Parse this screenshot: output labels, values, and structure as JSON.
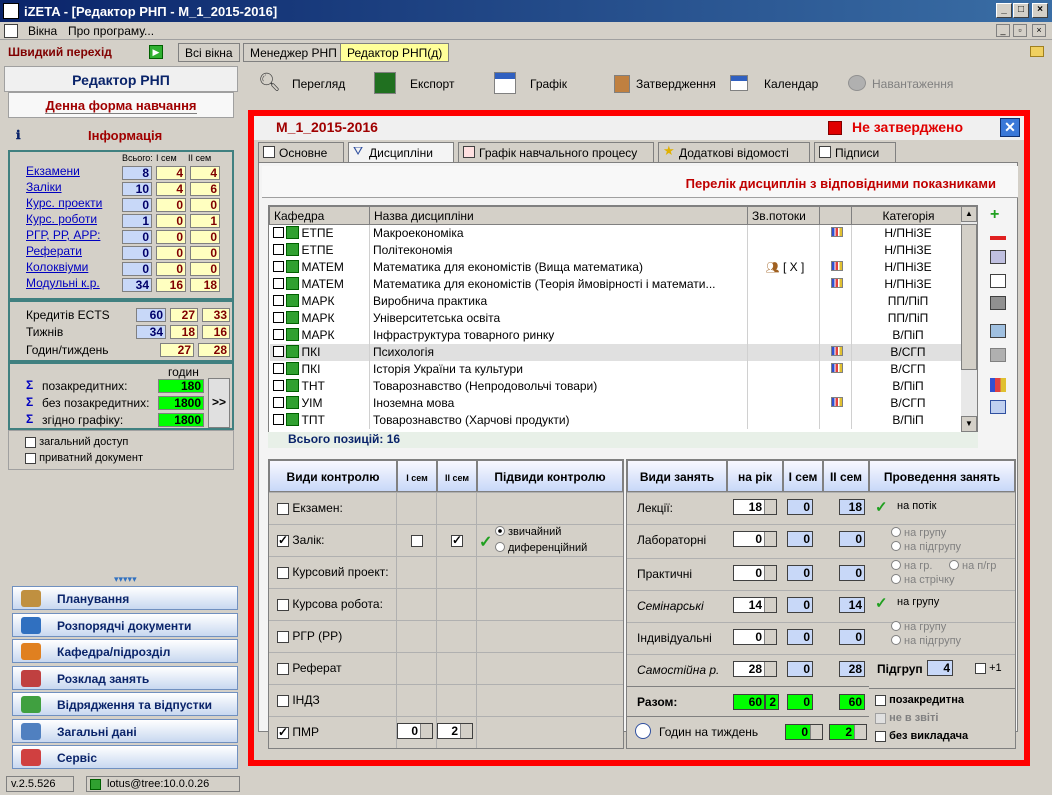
{
  "window": {
    "title": "iZETA - [Редактор РНП - М_1_2015-2016]"
  },
  "menu": [
    "Вікна",
    "Про програму..."
  ],
  "quick": {
    "label": "Швидкий перехід",
    "tabs": [
      "Всі вікна",
      "Менеджер РНП",
      "Редактор РНП(д)"
    ]
  },
  "left": {
    "title": "Редактор РНП",
    "form": "Денна форма навчання",
    "info": "Інформація",
    "cols": [
      "Всього:",
      "I сем",
      "II сем"
    ],
    "rows": [
      {
        "label": "Екзамени",
        "v": [
          "8",
          "4",
          "4"
        ]
      },
      {
        "label": "Заліки",
        "v": [
          "10",
          "4",
          "6"
        ]
      },
      {
        "label": "Курс. проекти",
        "v": [
          "0",
          "0",
          "0"
        ]
      },
      {
        "label": "Курс. роботи",
        "v": [
          "1",
          "0",
          "1"
        ]
      },
      {
        "label": "РГР, РР, АРР:",
        "v": [
          "0",
          "0",
          "0"
        ]
      },
      {
        "label": "Реферати",
        "v": [
          "0",
          "0",
          "0"
        ]
      },
      {
        "label": "Колоквіуми",
        "v": [
          "0",
          "0",
          "0"
        ]
      },
      {
        "label": "Модульні к.р.",
        "v": [
          "34",
          "16",
          "18"
        ]
      }
    ],
    "ects": {
      "label": "Кредитів ECTS",
      "v": [
        "60",
        "27",
        "33"
      ]
    },
    "weeks": {
      "label": "Тижнів",
      "v": [
        "34",
        "18",
        "16"
      ]
    },
    "hpw": {
      "label": "Годин/тиждень",
      "v": [
        "27",
        "28"
      ]
    },
    "hours_label": "годин",
    "sums": [
      {
        "label": "позакредитних:",
        "v": "180"
      },
      {
        "label": "без позакредитних:",
        "v": "1800"
      },
      {
        "label": "згідно графіку:",
        "v": "1800"
      }
    ],
    "more": ">>",
    "public": "загальний доступ",
    "private": "приватний документ",
    "nav": [
      "Планування",
      "Розпорядчі документи",
      "Кафедра/підрозділ",
      "Розклад занять",
      "Відрядження та відпустки",
      "Загальні дані",
      "Сервіс"
    ],
    "version": "v.2.5.526",
    "user": "lotus@tree:10.0.0.26"
  },
  "toolbar": [
    "Перегляд",
    "Експорт",
    "Графік",
    "Затвердження",
    "Календар",
    "Навантаження"
  ],
  "doc": {
    "name": "М_1_2015-2016",
    "status": "Не затверджено"
  },
  "tabs": [
    "Основне",
    "Дисципліни",
    "Графік навчального процесу",
    "Додаткові відомості",
    "Підписи"
  ],
  "section_title": "Перелік дисциплін з відповідними показниками",
  "table": {
    "headers": [
      "Кафедра",
      "Назва дисципліни",
      "Зв.потоки",
      "",
      "Категорія"
    ],
    "rows": [
      {
        "dept": "ЕТПЕ",
        "name": "Макроекономіка",
        "streams": "",
        "chart": true,
        "cat": "Н/ПНіЗЕ"
      },
      {
        "dept": "ЕТПЕ",
        "name": "Політекономія",
        "streams": "",
        "chart": false,
        "cat": "Н/ПНіЗЕ"
      },
      {
        "dept": "МАТЕМ",
        "name": "Математика для економістів (Вища математика)",
        "streams": "[ X ]",
        "chart": true,
        "cat": "Н/ПНіЗЕ"
      },
      {
        "dept": "МАТЕМ",
        "name": "Математика для економістів (Теорія ймовірності і математи...",
        "streams": "",
        "chart": true,
        "cat": "Н/ПНіЗЕ"
      },
      {
        "dept": "МАРК",
        "name": "Виробнича практика",
        "streams": "",
        "chart": false,
        "cat": "ПП/ПіП"
      },
      {
        "dept": "МАРК",
        "name": "Університетська освіта",
        "streams": "",
        "chart": false,
        "cat": "ПП/ПіП"
      },
      {
        "dept": "МАРК",
        "name": "Інфраструктура товарного ринку",
        "streams": "",
        "chart": false,
        "cat": "В/ПіП"
      },
      {
        "dept": "ПКІ",
        "name": "Психологія",
        "streams": "",
        "chart": true,
        "cat": "В/СГП"
      },
      {
        "dept": "ПКІ",
        "name": "Історія України та культури",
        "streams": "",
        "chart": true,
        "cat": "В/СГП"
      },
      {
        "dept": "ТНТ",
        "name": "Товарознавство (Непродовольчі товари)",
        "streams": "",
        "chart": false,
        "cat": "В/ПіП"
      },
      {
        "dept": "УІМ",
        "name": "Іноземна мова",
        "streams": "",
        "chart": true,
        "cat": "В/СГП"
      },
      {
        "dept": "ТПТ",
        "name": "Товарознавство (Харчові продукти)",
        "streams": "",
        "chart": false,
        "cat": "В/ПіП"
      }
    ],
    "total": "Всього позицій: 16"
  },
  "control": {
    "headers": [
      "Види контролю",
      "I сем",
      "II сем",
      "Підвиди контролю"
    ],
    "rows": [
      "Екзамен:",
      "Залік:",
      "Курсовий проект:",
      "Курсова робота:",
      "РГР (РР)",
      "Реферат",
      "ІНДЗ",
      "ПМР"
    ],
    "subtypes": [
      "звичайний",
      "диференційний"
    ],
    "pmr": [
      "0",
      "2"
    ]
  },
  "classes": {
    "headers": [
      "Види занять",
      "на рік",
      "I сем",
      "II сем",
      "Проведення занять"
    ],
    "rows": [
      {
        "label": "Лекції:",
        "year": "18",
        "s1": "0",
        "s2": "18"
      },
      {
        "label": "Лабораторні",
        "year": "0",
        "s1": "0",
        "s2": "0"
      },
      {
        "label": "Практичні",
        "year": "0",
        "s1": "0",
        "s2": "0"
      },
      {
        "label": "Семінарські",
        "year": "14",
        "s1": "0",
        "s2": "14"
      },
      {
        "label": "Індивідуальні",
        "year": "0",
        "s1": "0",
        "s2": "0"
      },
      {
        "label": "Самостійна р.",
        "year": "28",
        "s1": "0",
        "s2": "28"
      }
    ],
    "total": {
      "label": "Разом:",
      "year": "60",
      "year2": "2",
      "s1": "0",
      "s2": "60"
    },
    "hpw": {
      "label": "Годин на тиждень",
      "s1": "0",
      "s2": "2"
    },
    "conduct": {
      "r0": "на потік",
      "r1a": "на групу",
      "r1b": "на підгрупу",
      "r2a": "на гр.",
      "r2b": "на п/гр",
      "r2c": "на стрічку",
      "r3": "на групу",
      "r4a": "на групу",
      "r4b": "на підгрупу"
    },
    "subgroups": {
      "label": "Підгруп",
      "value": "4",
      "plus": "+1"
    },
    "flags": [
      "позакредитна",
      "не в звіті",
      "без викладача"
    ]
  }
}
